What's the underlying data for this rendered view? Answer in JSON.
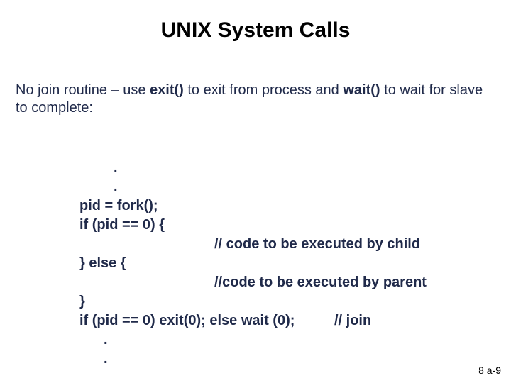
{
  "title": "UNIX System Calls",
  "intro": {
    "t1": "No join routine – use ",
    "b1": "exit()",
    "t2": " to exit from process and ",
    "b2": "wait()",
    "t3": " to wait for slave to complete:"
  },
  "code": {
    "d1": ".",
    "d2": ".",
    "l1": "pid = fork();",
    "l2": "if (pid == 0) {",
    "c1": "// code to be executed by child",
    "l3": "} else {",
    "c2": "//code to be executed by parent",
    "l4": "}",
    "l5": "if (pid == 0) exit(0); else wait (0);          // join",
    "d3": ".",
    "d4": "."
  },
  "footer": "8 a-9"
}
